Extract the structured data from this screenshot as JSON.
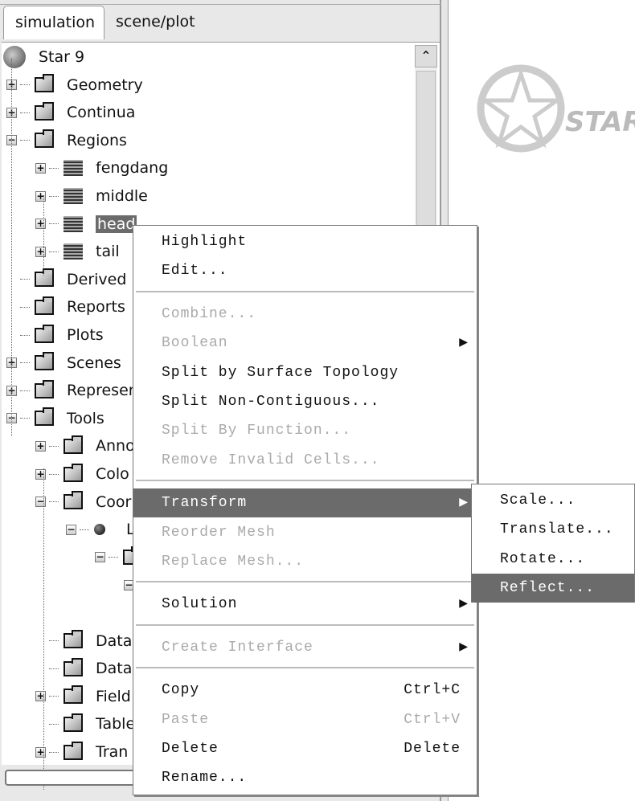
{
  "tabs": [
    {
      "label": "simulation",
      "active": true
    },
    {
      "label": "scene/plot",
      "active": false
    }
  ],
  "tree": {
    "root": "Star 9",
    "items": [
      {
        "label": "Geometry",
        "level": 0,
        "expander": "+",
        "icon": "folder"
      },
      {
        "label": "Continua",
        "level": 0,
        "expander": "+",
        "icon": "folder"
      },
      {
        "label": "Regions",
        "level": 0,
        "expander": "-",
        "icon": "folder"
      },
      {
        "label": "fengdang",
        "level": 1,
        "expander": "+",
        "icon": "region"
      },
      {
        "label": "middle",
        "level": 1,
        "expander": "+",
        "icon": "region"
      },
      {
        "label": "head",
        "level": 1,
        "expander": "+",
        "icon": "region",
        "selected": true
      },
      {
        "label": "tail",
        "level": 1,
        "expander": "+",
        "icon": "region"
      },
      {
        "label": "Derived P",
        "level": 0,
        "expander": "",
        "icon": "folder"
      },
      {
        "label": "Reports",
        "level": 0,
        "expander": "",
        "icon": "folder"
      },
      {
        "label": "Plots",
        "level": 0,
        "expander": "",
        "icon": "folder"
      },
      {
        "label": "Scenes",
        "level": 0,
        "expander": "+",
        "icon": "folder"
      },
      {
        "label": "Represen",
        "level": 0,
        "expander": "+",
        "icon": "folder"
      },
      {
        "label": "Tools",
        "level": 0,
        "expander": "-",
        "icon": "folder"
      },
      {
        "label": "Anno",
        "level": 1,
        "expander": "+",
        "icon": "folder"
      },
      {
        "label": "Colo",
        "level": 1,
        "expander": "+",
        "icon": "folder"
      },
      {
        "label": "Coor",
        "level": 1,
        "expander": "-",
        "icon": "folder"
      },
      {
        "label": "L",
        "level": 2,
        "expander": "-",
        "icon": "sphere"
      },
      {
        "label": "",
        "level": 3,
        "expander": "-",
        "icon": "folder"
      },
      {
        "label": "",
        "level": 4,
        "expander": "-",
        "icon": ""
      },
      {
        "label": "",
        "level": -1,
        "expander": "",
        "icon": ""
      },
      {
        "label": "Data",
        "level": 1,
        "expander": "",
        "icon": "folder"
      },
      {
        "label": "Data",
        "level": 1,
        "expander": "",
        "icon": "folder"
      },
      {
        "label": "Field",
        "level": 1,
        "expander": "+",
        "icon": "folder"
      },
      {
        "label": "Table",
        "level": 1,
        "expander": "",
        "icon": "folder"
      },
      {
        "label": "Tran",
        "level": 1,
        "expander": "+",
        "icon": "folder"
      }
    ]
  },
  "logo_text": "STAR",
  "context_menu": {
    "items": [
      {
        "label": "Highlight",
        "enabled": true
      },
      {
        "label": "Edit...",
        "enabled": true
      },
      {
        "sep": true
      },
      {
        "label": "Combine...",
        "enabled": false
      },
      {
        "label": "Boolean",
        "enabled": false,
        "submenu": true
      },
      {
        "label": "Split by Surface Topology",
        "enabled": true
      },
      {
        "label": "Split Non-Contiguous...",
        "enabled": true
      },
      {
        "label": "Split By Function...",
        "enabled": false
      },
      {
        "label": "Remove Invalid Cells...",
        "enabled": false
      },
      {
        "sep": true
      },
      {
        "label": "Transform",
        "enabled": true,
        "submenu": true,
        "highlighted": true
      },
      {
        "label": "Reorder Mesh",
        "enabled": false
      },
      {
        "label": "Replace Mesh...",
        "enabled": false
      },
      {
        "sep": true
      },
      {
        "label": "Solution",
        "enabled": true,
        "submenu": true
      },
      {
        "sep": true
      },
      {
        "label": "Create Interface",
        "enabled": false,
        "submenu": true
      },
      {
        "sep": true
      },
      {
        "label": "Copy",
        "enabled": true,
        "shortcut": "Ctrl+C"
      },
      {
        "label": "Paste",
        "enabled": false,
        "shortcut": "Ctrl+V"
      },
      {
        "label": "Delete",
        "enabled": true,
        "shortcut": "Delete"
      },
      {
        "label": "Rename...",
        "enabled": true
      }
    ]
  },
  "transform_submenu": {
    "items": [
      {
        "label": "Scale..."
      },
      {
        "label": "Translate..."
      },
      {
        "label": "Rotate..."
      },
      {
        "label": "Reflect...",
        "highlighted": true
      }
    ]
  }
}
